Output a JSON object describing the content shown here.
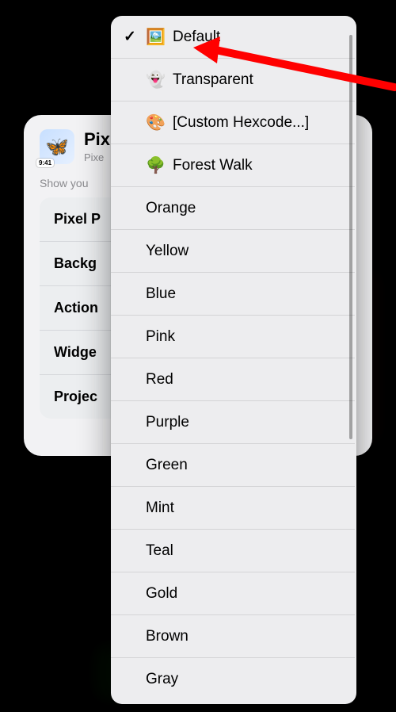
{
  "arrow_color": "#ff0000",
  "card": {
    "app_icon_emoji": "🦋",
    "app_icon_badge": "9:41",
    "title": "Pix",
    "subtitle": "Pixe",
    "tagline": "Show you",
    "rows": [
      "Pixel P",
      "Backg",
      "Action",
      "Widge",
      "Projec"
    ]
  },
  "menu": {
    "items": [
      {
        "selected": true,
        "icon": "🖼️",
        "label": "Default"
      },
      {
        "selected": false,
        "icon": "👻",
        "label": "Transparent"
      },
      {
        "selected": false,
        "icon": "🎨",
        "label": "[Custom Hexcode...]"
      },
      {
        "selected": false,
        "icon": "🌳",
        "label": "Forest Walk"
      },
      {
        "selected": false,
        "icon": "",
        "label": "Orange"
      },
      {
        "selected": false,
        "icon": "",
        "label": "Yellow"
      },
      {
        "selected": false,
        "icon": "",
        "label": "Blue"
      },
      {
        "selected": false,
        "icon": "",
        "label": "Pink"
      },
      {
        "selected": false,
        "icon": "",
        "label": "Red"
      },
      {
        "selected": false,
        "icon": "",
        "label": "Purple"
      },
      {
        "selected": false,
        "icon": "",
        "label": "Green"
      },
      {
        "selected": false,
        "icon": "",
        "label": "Mint"
      },
      {
        "selected": false,
        "icon": "",
        "label": "Teal"
      },
      {
        "selected": false,
        "icon": "",
        "label": "Gold"
      },
      {
        "selected": false,
        "icon": "",
        "label": "Brown"
      },
      {
        "selected": false,
        "icon": "",
        "label": "Gray"
      }
    ]
  }
}
